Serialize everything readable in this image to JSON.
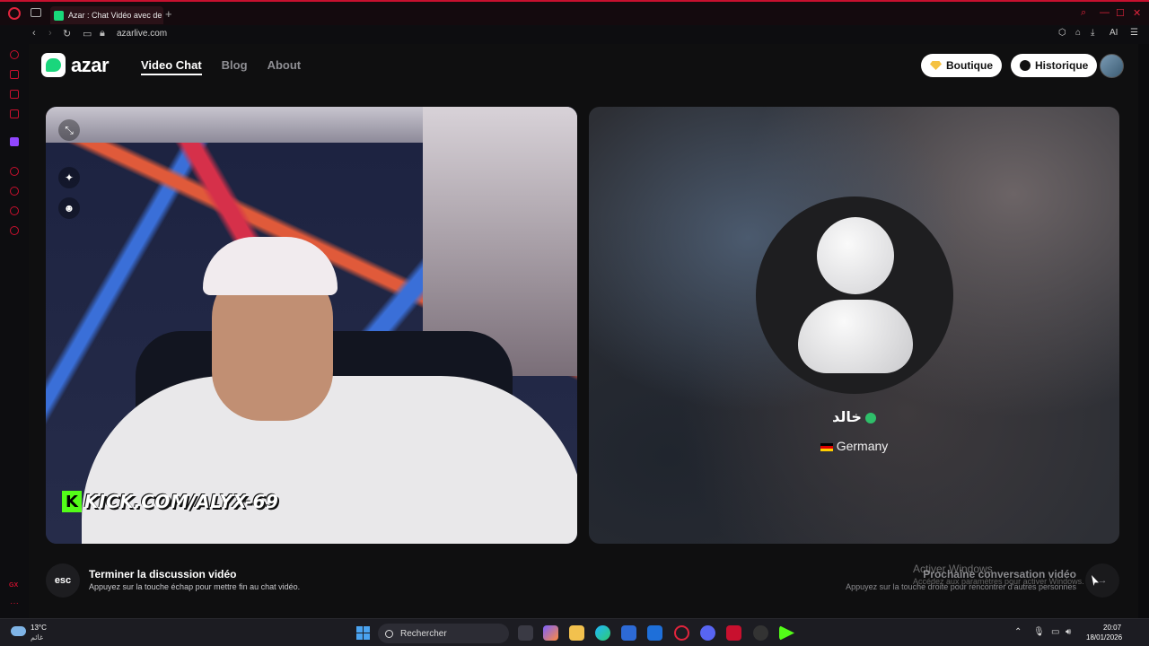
{
  "browser": {
    "tab_title": "Azar : Chat Vidéo avec de",
    "new_tab_glyph": "+",
    "url": "azarlive.com",
    "ai_label": "AI"
  },
  "sidebar": {
    "gx_label": "GX",
    "more_glyph": "···"
  },
  "site": {
    "logo_text": "azar",
    "nav": [
      {
        "label": "Video Chat",
        "active": true
      },
      {
        "label": "Blog",
        "active": false
      },
      {
        "label": "About",
        "active": false
      }
    ],
    "boutique_label": "Boutique",
    "history_label": "Historique"
  },
  "self_cam": {
    "overlay_text": "KICK.COM/ALYX-69",
    "kick_letter": "K"
  },
  "peer": {
    "name": "خالد",
    "country": "Germany"
  },
  "bottom": {
    "esc_key": "esc",
    "end_title": "Terminer la discussion vidéo",
    "end_sub": "Appuyez sur la touche échap pour mettre fin au chat vidéo.",
    "next_title": "Prochaine conversation vidéo",
    "next_sub": "Appuyez sur la touche droite pour rencontrer d'autres personnes",
    "next_key": "→",
    "activate_title": "Activer Windows",
    "activate_sub": "Accédez aux paramètres pour activer Windows."
  },
  "taskbar": {
    "temp": "13°C",
    "weather_sub": "غائم",
    "search_placeholder": "Rechercher",
    "time": "20:07",
    "date": "18/01/2026"
  },
  "colors": {
    "accent_brand": "#1ad67c",
    "opera_red": "#c8102e",
    "kick_green": "#53fc18"
  }
}
